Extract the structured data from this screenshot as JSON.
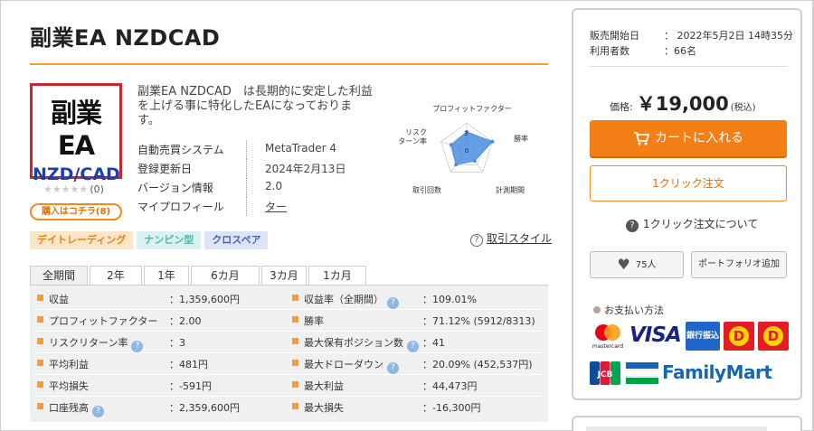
{
  "product": {
    "title": "副業EA NZDCAD",
    "logo_line1": "副業EA",
    "logo_line2": "NZD/CAD",
    "rating_stars": "★★★★★",
    "rating_count": "(0)",
    "buy_pill_label": "購入はコチラ(8)",
    "description": "副業EA NZDCAD　は長期的に安定した利益を上げる事に特化したEAになっております。",
    "specs": [
      {
        "key": "自動売買システム",
        "value": "MetaTrader 4"
      },
      {
        "key": "登録更新日",
        "value": "2024年2月13日"
      },
      {
        "key": "バージョン情報",
        "value": "2.0"
      },
      {
        "key": "マイプロフィール",
        "value": "ター"
      }
    ],
    "tags": [
      "デイトレーディング",
      "ナンピン型",
      "クロスペア"
    ],
    "trade_style_link": "取引スタイル"
  },
  "radar": {
    "axes": [
      "プロフィットファクター",
      "勝率",
      "計測期間",
      "取引回数",
      "リスク\nターン率"
    ],
    "axis_label_1": "プロフィットファクター",
    "axis_label_2": "勝率",
    "axis_label_3": "計測期間",
    "axis_label_4": "取引回数",
    "axis_label_5a": "リスク",
    "axis_label_5b": "ターン率",
    "tick_3": "3",
    "tick_0": "0",
    "values": [
      2.0,
      3.0,
      1.5,
      2.0,
      1.8
    ],
    "max": 3,
    "color": "#4a8fe0"
  },
  "tabs": [
    "全期間",
    "2年",
    "1年",
    "6カ月",
    "3カ月",
    "1カ月"
  ],
  "stats": {
    "left": [
      {
        "key": "収益",
        "value": "：1,359,600円",
        "info": false
      },
      {
        "key": "プロフィットファクター",
        "value": "：2.00",
        "info": false
      },
      {
        "key": "リスクリターン率",
        "value": "：3",
        "info": true
      },
      {
        "key": "平均利益",
        "value": "：481円",
        "info": false
      },
      {
        "key": "平均損失",
        "value": "：-591円",
        "info": false
      },
      {
        "key": "口座残高",
        "value": "：2,359,600円",
        "info": true
      }
    ],
    "right": [
      {
        "key": "収益率（全期間）",
        "value": "：109.01%",
        "info": true
      },
      {
        "key": "勝率",
        "value": "：71.12% (5912/8313)",
        "info": false
      },
      {
        "key": "最大保有ポジション数",
        "value": "：41",
        "info": true
      },
      {
        "key": "最大ドローダウン",
        "value": "：20.09% (452,537円)",
        "info": true
      },
      {
        "key": "最大利益",
        "value": "：44,473円",
        "info": false
      },
      {
        "key": "最大損失",
        "value": "：-16,300円",
        "info": false
      }
    ],
    "info_glyph": "?"
  },
  "purchase": {
    "sale_start_label": "販売開始日",
    "sale_start_value": "：  2022年5月2日 14時35分",
    "users_label": "利用者数",
    "users_value": "：66名",
    "price_label": "価格:",
    "price_value": "￥19,000",
    "price_tax": "(税込)",
    "cart_label": "カートに入れる",
    "oneclick_label": "1クリック注文",
    "oneclick_help": "1クリック注文について",
    "like_count": "75人",
    "portfolio_label": "ポートフォリオ追加",
    "payment_title": "お支払い方法",
    "payment": {
      "mastercard": "mastercard",
      "visa": "VISA",
      "bank": "銀行振込",
      "d1": "D",
      "d2": "D",
      "jcb": "JCB",
      "familymart": "FamilyMart"
    }
  }
}
